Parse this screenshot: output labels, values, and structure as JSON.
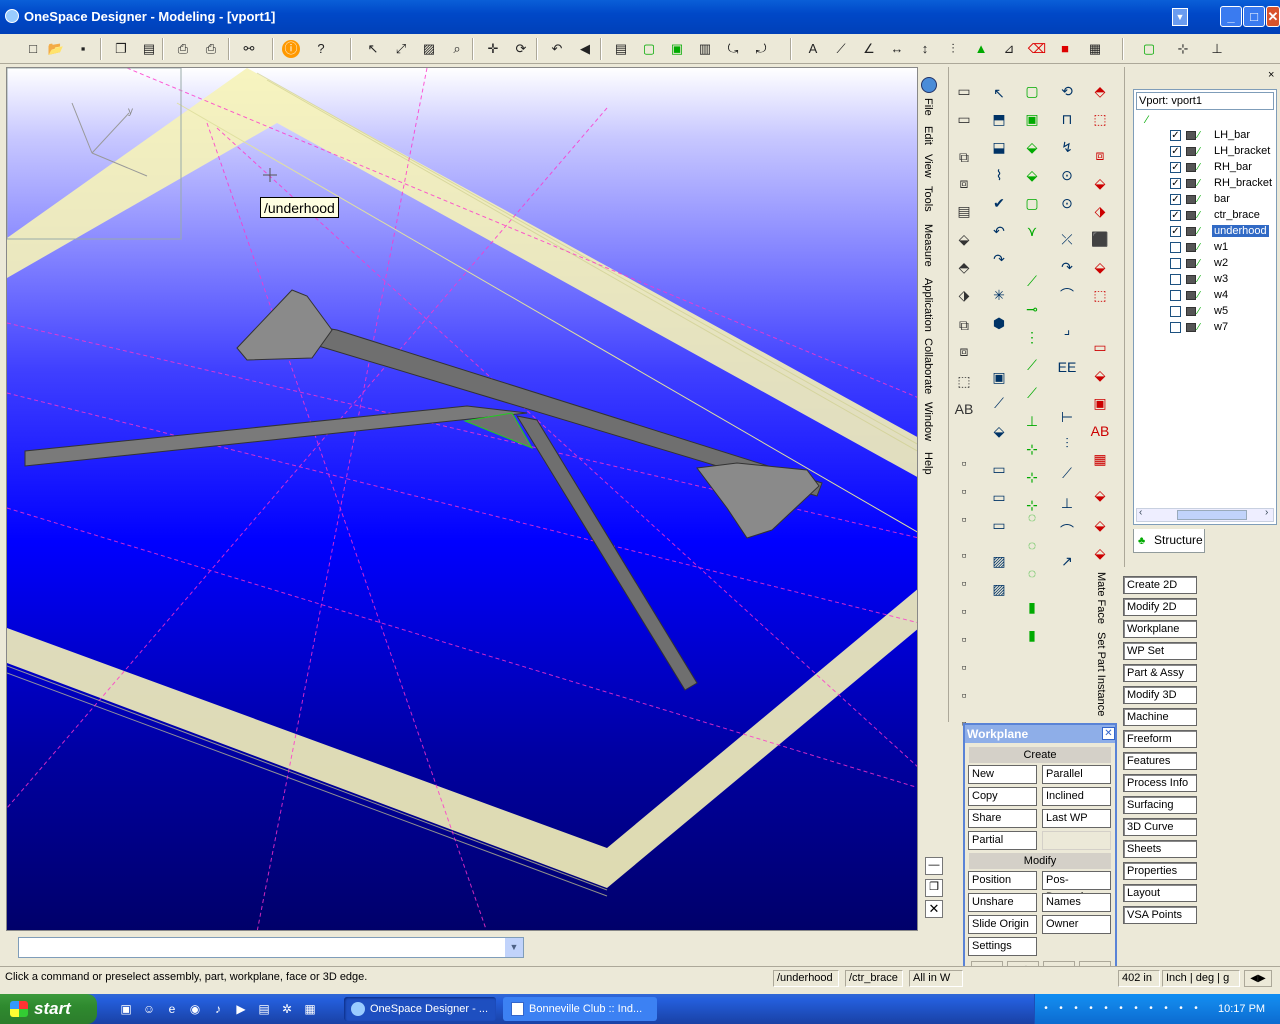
{
  "window": {
    "title": "OneSpace Designer - Modeling - [vport1]",
    "minimize": "_",
    "maximize": "□",
    "close": "✕"
  },
  "viewport": {
    "tooltip": "/underhood",
    "axis_label": "y"
  },
  "menu_strip": [
    "File",
    "Edit",
    "View",
    "Tools",
    "Measure",
    "Application",
    "Collaborate",
    "Window",
    "Help"
  ],
  "side_labels": [
    "Mate Face",
    "Set Part Instance"
  ],
  "structure": {
    "header": "Vport: vport1",
    "tab": "Structure",
    "items": [
      {
        "label": "LH_bar",
        "checked": true
      },
      {
        "label": "LH_bracket",
        "checked": true
      },
      {
        "label": "RH_bar",
        "checked": true
      },
      {
        "label": "RH_bracket",
        "checked": true
      },
      {
        "label": "bar",
        "checked": true
      },
      {
        "label": "ctr_brace",
        "checked": true
      },
      {
        "label": "underhood",
        "checked": true
      },
      {
        "label": "w1",
        "checked": false
      },
      {
        "label": "w2",
        "checked": false
      },
      {
        "label": "w3",
        "checked": false
      },
      {
        "label": "w4",
        "checked": false
      },
      {
        "label": "w5",
        "checked": false
      },
      {
        "label": "w7",
        "checked": false
      }
    ]
  },
  "app_buttons": [
    "Create 2D",
    "Modify 2D",
    "Workplane",
    "WP Set",
    "Part & Assy",
    "Modify 3D",
    "Machine",
    "Freeform",
    "Features",
    "Process Info",
    "Surfacing",
    "3D Curve",
    "Sheets",
    "Properties",
    "Layout",
    "VSA Points"
  ],
  "workplane": {
    "title": "Workplane",
    "create_label": "Create",
    "modify_label": "Modify",
    "create_buttons": [
      "New",
      "Parallel",
      "Copy",
      "Inclined",
      "Share",
      "Last WP",
      "Partial"
    ],
    "modify_buttons": [
      "Position",
      "Pos-Dynamic",
      "Unshare",
      "Names",
      "Slide Origin",
      "Owner",
      "Settings"
    ],
    "bottom_icons": [
      "✓",
      "✗",
      "?",
      "⇥"
    ]
  },
  "command_line": {
    "value": ""
  },
  "status": {
    "message": "Click a command or preselect assembly, part, workplane, face or 3D edge.",
    "active_part": "/underhood",
    "active_assy": "/ctr_brace",
    "selection": "All in W",
    "length": "402 in",
    "units": "Inch | deg | g"
  },
  "taskbar": {
    "start": "start",
    "tasks": [
      "OneSpace Designer - ...",
      "Bonneville Club :: Ind..."
    ],
    "clock": "10:17 PM"
  },
  "colors": {
    "titlebar": "#0048c8",
    "viewport_bg": "#0000ff",
    "grid": "#ff33cc",
    "workplane_frame": "#ffff99",
    "selection": "#316ac5"
  }
}
